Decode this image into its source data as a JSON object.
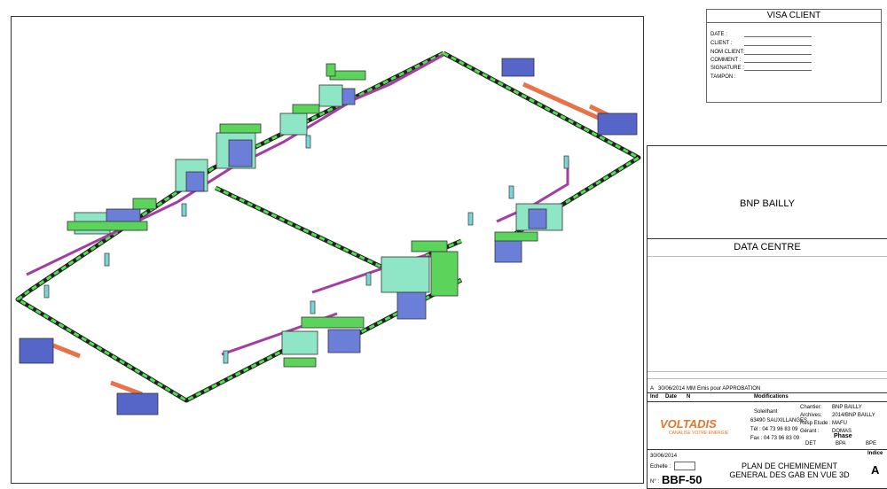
{
  "visa": {
    "title": "VISA CLIENT",
    "fields": [
      "DATE :",
      "CLIENT :",
      "NOM CLIENT:",
      "COMMENT :",
      "SIGNATURE :",
      "TAMPON :"
    ]
  },
  "title_block": {
    "project": "BNP BAILLY",
    "site": "DATA CENTRE",
    "revision": {
      "index": "A",
      "date": "30/06/2014",
      "author": "MM",
      "description": "Emis pour APPROBATION"
    },
    "revision_headers": {
      "ind": "Ind",
      "date": "Date",
      "n": "N",
      "modifications": "Modifications"
    },
    "company": {
      "name": "VOLTADIS",
      "tagline": "CANALISE VOTRE ENERGIE",
      "location": "Soleilhant",
      "postcode": "63490 SAUXILLANGES",
      "tel": "Tél : 04 73 96 83 09",
      "fax": "Fax : 04 73 96 83 09"
    },
    "info": [
      {
        "label": "Chantier:",
        "value": "BNP BAILLY"
      },
      {
        "label": "Archives:",
        "value": "2014/BNP BAILLY"
      },
      {
        "label": "Resp Etude :",
        "value": "MAFU"
      },
      {
        "label": "Gérant :",
        "value": "DOMAS"
      }
    ],
    "phase": {
      "label": "Phase",
      "options": [
        "DET",
        "BPA",
        "BPE"
      ]
    },
    "date": "30/06/2014",
    "echelle_label": "Echelle :",
    "number_label": "N° :",
    "number": "BBF-50",
    "title_line1": "PLAN DE CHEMINEMENT",
    "title_line2": "GENERAL DES GAB EN VUE 3D",
    "indice_label": "Indice",
    "indice": "A"
  }
}
